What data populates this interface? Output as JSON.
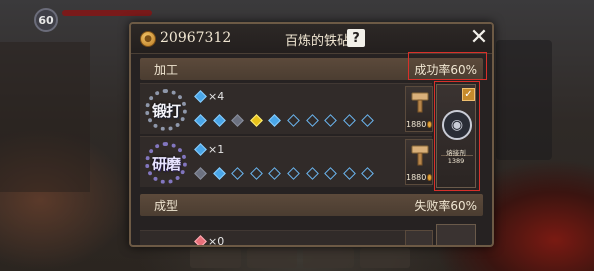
{
  "header": {
    "coin_amount": "20967312",
    "title": "百炼的铁砧",
    "help_label": "?",
    "close_label": "✕"
  },
  "sections": {
    "processing": {
      "label": "加工",
      "rate": "成功率60%"
    },
    "forming": {
      "label": "成型",
      "rate": "失败率60%"
    }
  },
  "rows": [
    {
      "name": "锻打",
      "gem_count": "×4",
      "track": [
        "filled",
        "filled",
        "gray",
        "gold",
        "filled",
        "empty",
        "empty",
        "empty",
        "empty",
        "empty"
      ],
      "cost": "1880"
    },
    {
      "name": "研磨",
      "gem_count": "×1",
      "track": [
        "gray",
        "filled",
        "empty",
        "empty",
        "empty",
        "empty",
        "empty",
        "empty",
        "empty",
        "empty"
      ],
      "cost": "1880"
    }
  ],
  "partial_row": {
    "gem_count": "×0"
  },
  "item_card": {
    "checked": "✓",
    "name": "熔接剂",
    "count": "1389"
  },
  "background": {
    "level": "60"
  },
  "colors": {
    "accent_red": "#d8302a",
    "gem_blue": "#4aa6e8",
    "gem_gold": "#e8c21a",
    "panel_brown": "#5c4a3b"
  }
}
